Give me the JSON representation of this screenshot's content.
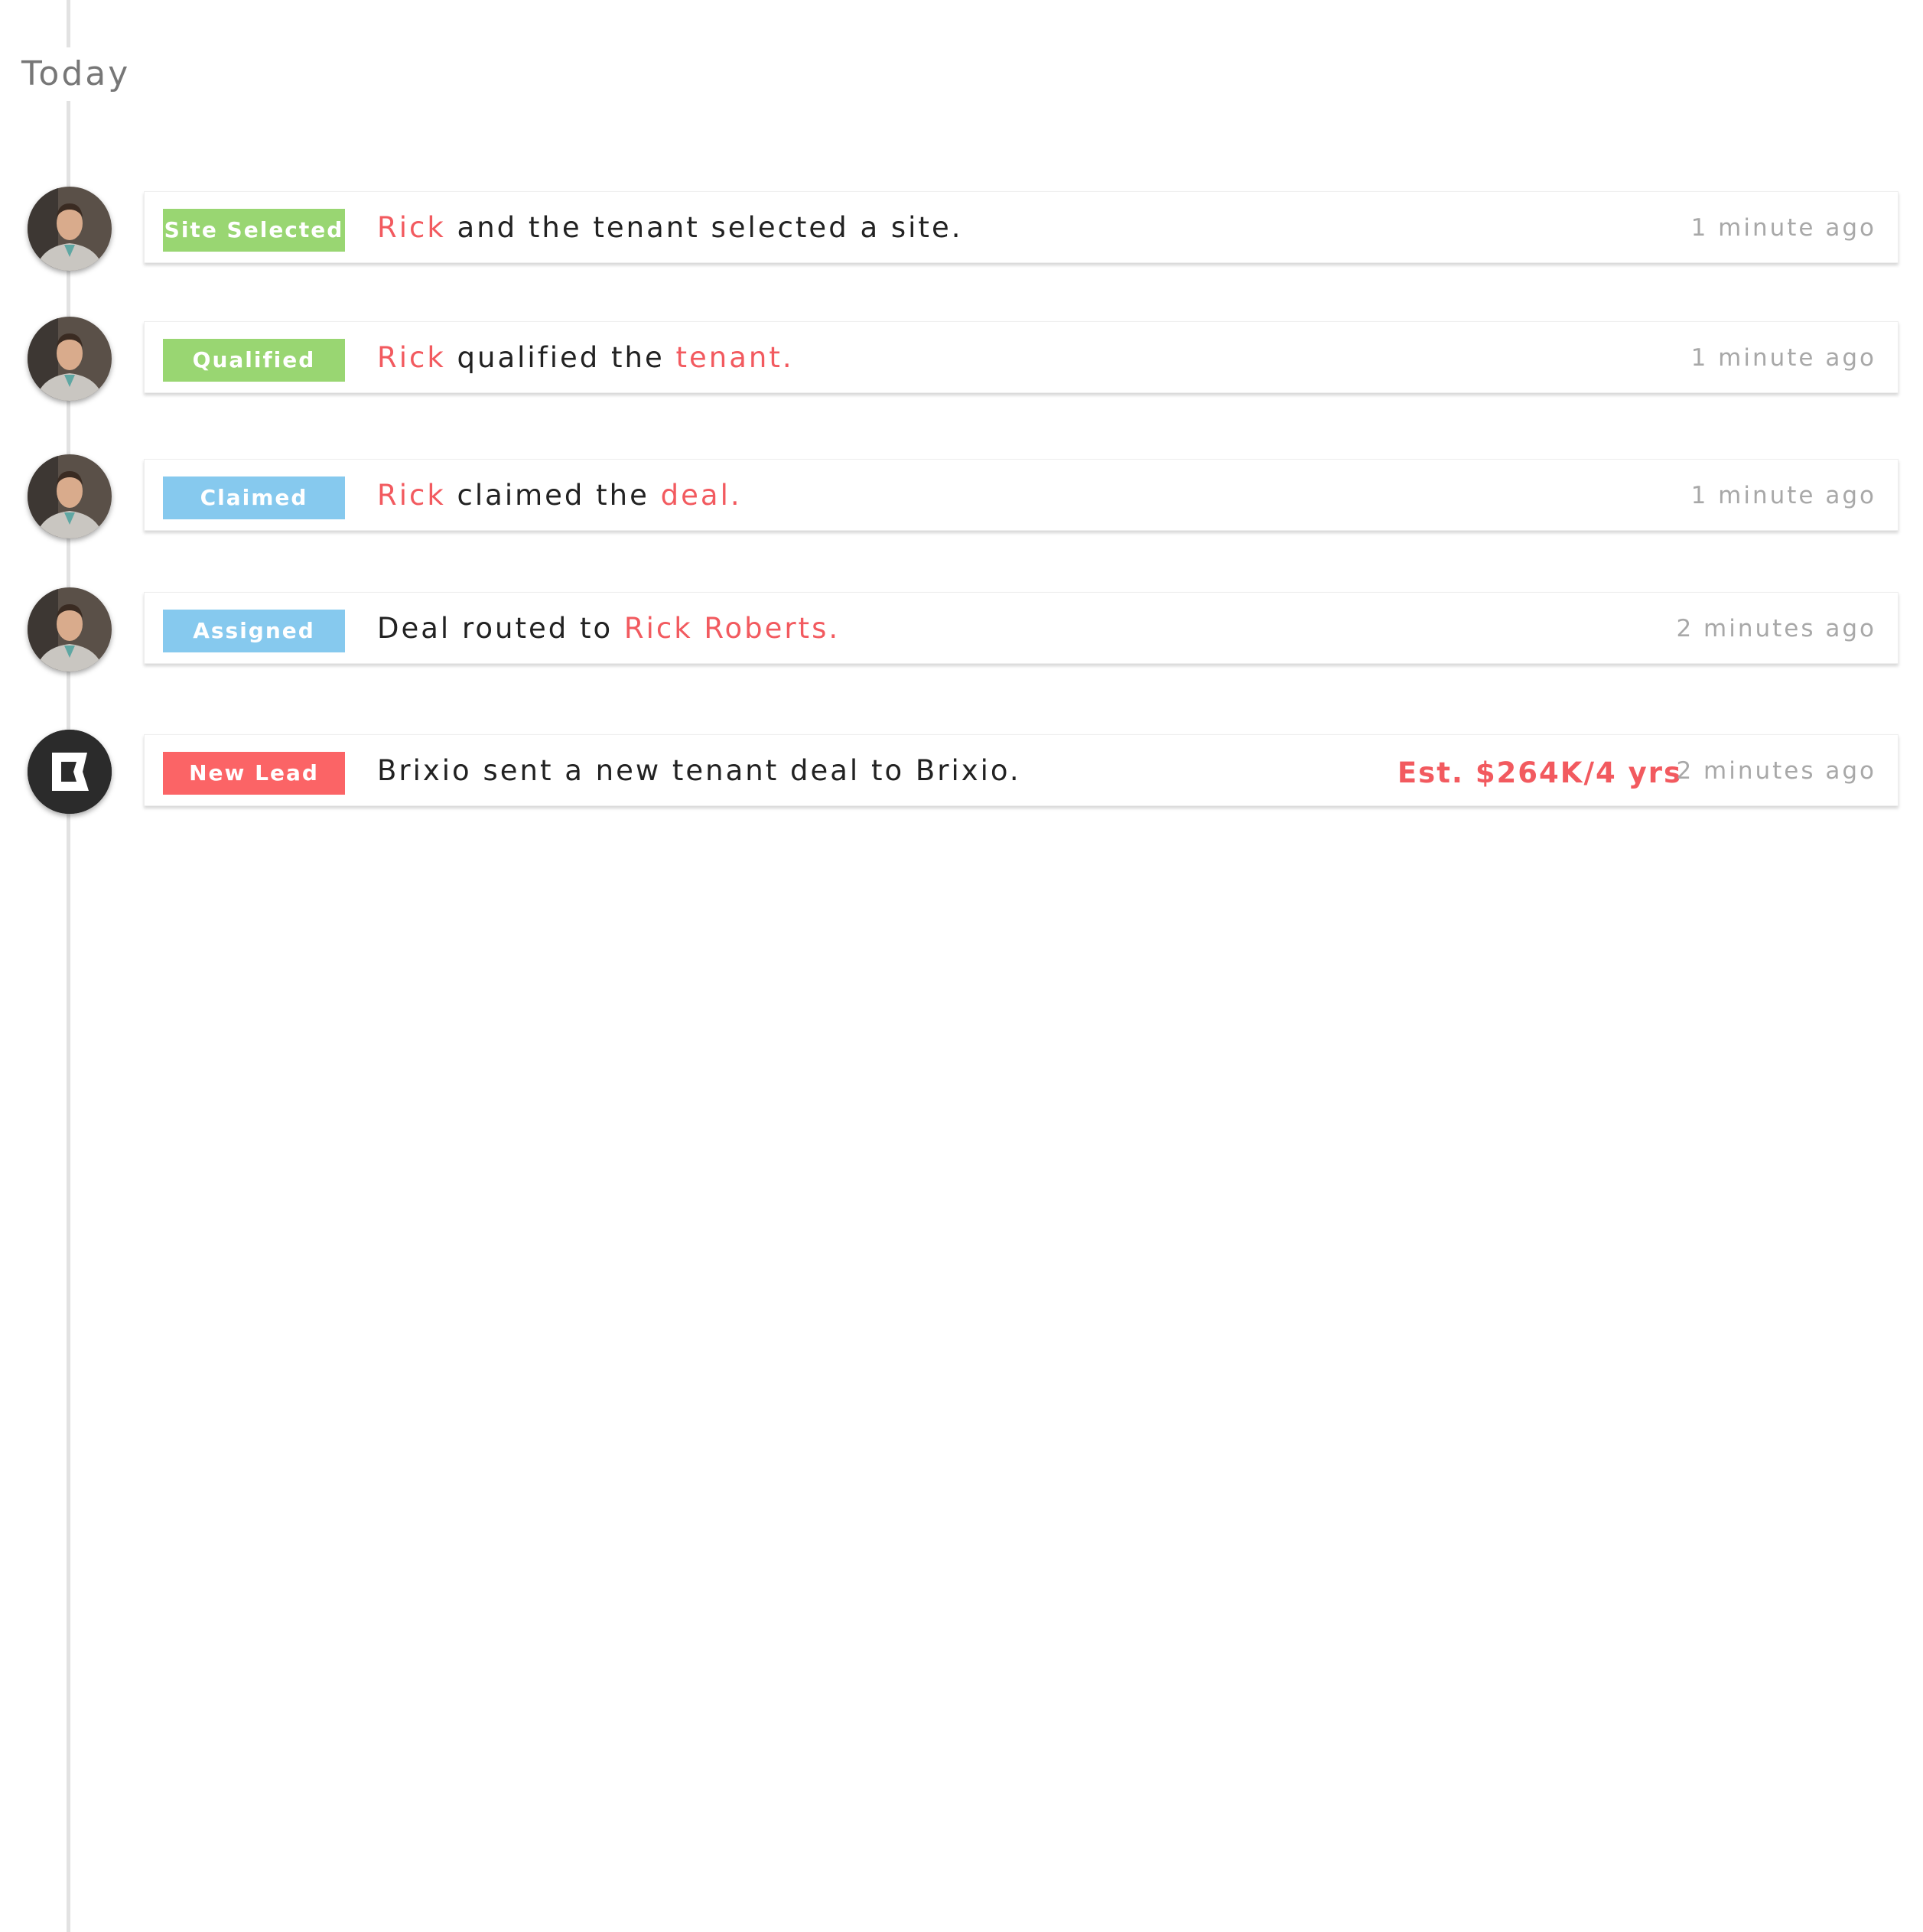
{
  "timeline": {
    "section_label": "Today"
  },
  "colors": {
    "accent": "#f25a5f",
    "badge_green": "#99d672",
    "badge_blue": "#86c9ee",
    "badge_red": "#fb6466",
    "muted_text": "#a8a8a8",
    "timeline_line": "#e2e2e2"
  },
  "events": [
    {
      "avatar_icon": "user-avatar",
      "badge": "Site Selected",
      "badge_color": "#99d672",
      "message": [
        {
          "text": "Rick",
          "highlight": true
        },
        {
          "text": " and the tenant selected a site.",
          "highlight": false
        }
      ],
      "time": "1 minute ago"
    },
    {
      "avatar_icon": "user-avatar",
      "badge": "Qualified",
      "badge_color": "#99d672",
      "message": [
        {
          "text": "Rick",
          "highlight": true
        },
        {
          "text": " qualified the ",
          "highlight": false
        },
        {
          "text": "tenant.",
          "highlight": true
        }
      ],
      "time": "1 minute ago"
    },
    {
      "avatar_icon": "user-avatar",
      "badge": "Claimed",
      "badge_color": "#86c9ee",
      "message": [
        {
          "text": "Rick",
          "highlight": true
        },
        {
          "text": " claimed the ",
          "highlight": false
        },
        {
          "text": "deal.",
          "highlight": true
        }
      ],
      "time": "1 minute ago"
    },
    {
      "avatar_icon": "user-avatar",
      "badge": "Assigned",
      "badge_color": "#86c9ee",
      "message": [
        {
          "text": "Deal routed to ",
          "highlight": false
        },
        {
          "text": "Rick Roberts.",
          "highlight": true
        }
      ],
      "time": "2 minutes ago"
    },
    {
      "avatar_icon": "brixio-logo-icon",
      "badge": "New Lead",
      "badge_color": "#fb6466",
      "message": [
        {
          "text": "Brixio sent a new tenant deal to Brixio.",
          "highlight": false
        }
      ],
      "estimate": "Est. $264K/4 yrs",
      "time": "2 minutes ago"
    }
  ]
}
